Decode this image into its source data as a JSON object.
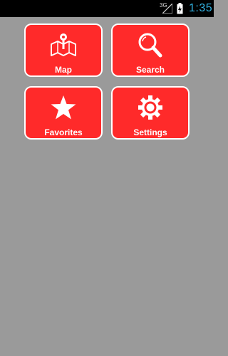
{
  "status_bar": {
    "network": "3G",
    "time": "1:35",
    "time_color": "#33b5e5"
  },
  "menu": {
    "tile_color": "#ff2a2a",
    "background_color": "#9a9a9a",
    "items": [
      {
        "label": "Map",
        "icon": "map-pin-icon"
      },
      {
        "label": "Search",
        "icon": "magnifier-icon"
      },
      {
        "label": "Favorites",
        "icon": "star-icon"
      },
      {
        "label": "Settings",
        "icon": "gear-icon"
      }
    ]
  }
}
